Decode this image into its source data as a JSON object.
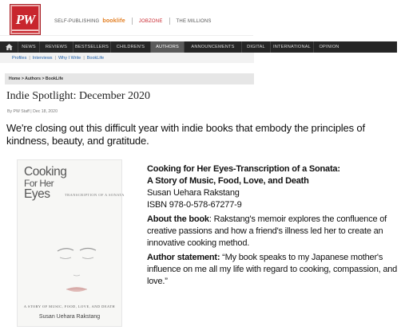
{
  "header": {
    "logo": "PW",
    "links": {
      "self_publishing": "SELF-PUBLISHING",
      "booklife": "booklife",
      "jobzone": "JOBZONE",
      "millions": "THE MILLIONS"
    }
  },
  "nav": {
    "items": [
      "NEWS",
      "REVIEWS",
      "BESTSELLERS",
      "CHILDREN'S",
      "AUTHORS",
      "ANNOUNCEMENTS",
      "DIGITAL",
      "INTERNATIONAL",
      "OPINION"
    ],
    "active": "AUTHORS"
  },
  "subnav": [
    "Profiles",
    "Interviews",
    "Why I Write",
    "BookLife"
  ],
  "breadcrumb": "Home > Authors > BookLife",
  "article": {
    "title": "Indie Spotlight: December 2020",
    "byline": "By PW Staff | Dec 18, 2020",
    "intro": "We're closing out this difficult year with indie books that embody the principles of kindness, beauty, and gratitude."
  },
  "cover": {
    "title_line1": "Cooking",
    "title_line2": "For Her",
    "title_line3": "Eyes",
    "subtitle": "TRANSCRIPTION OF A SONATA",
    "tagline": "A STORY OF MUSIC, FOOD, LOVE, AND DEATH",
    "author": "Susan Uehara Rakstang"
  },
  "book": {
    "title_line1": "Cooking for Her Eyes-Transcription of a Sonata:",
    "title_line2": "A Story of Music, Food, Love, and Death",
    "author": "Susan  Uehara Rakstang",
    "isbn": "ISBN 978-0-578-67277-9",
    "about_label": "About the book",
    "about_text": ": Rakstang's memoir explores the confluence of creative passions  and how a friend's illness  led her to create an innovative cooking method.",
    "statement_label": "Author statement:",
    "statement_text": " “My book speaks to my Japanese mother's influence on me all my life with regard to cooking, compassion,  and love.”"
  }
}
